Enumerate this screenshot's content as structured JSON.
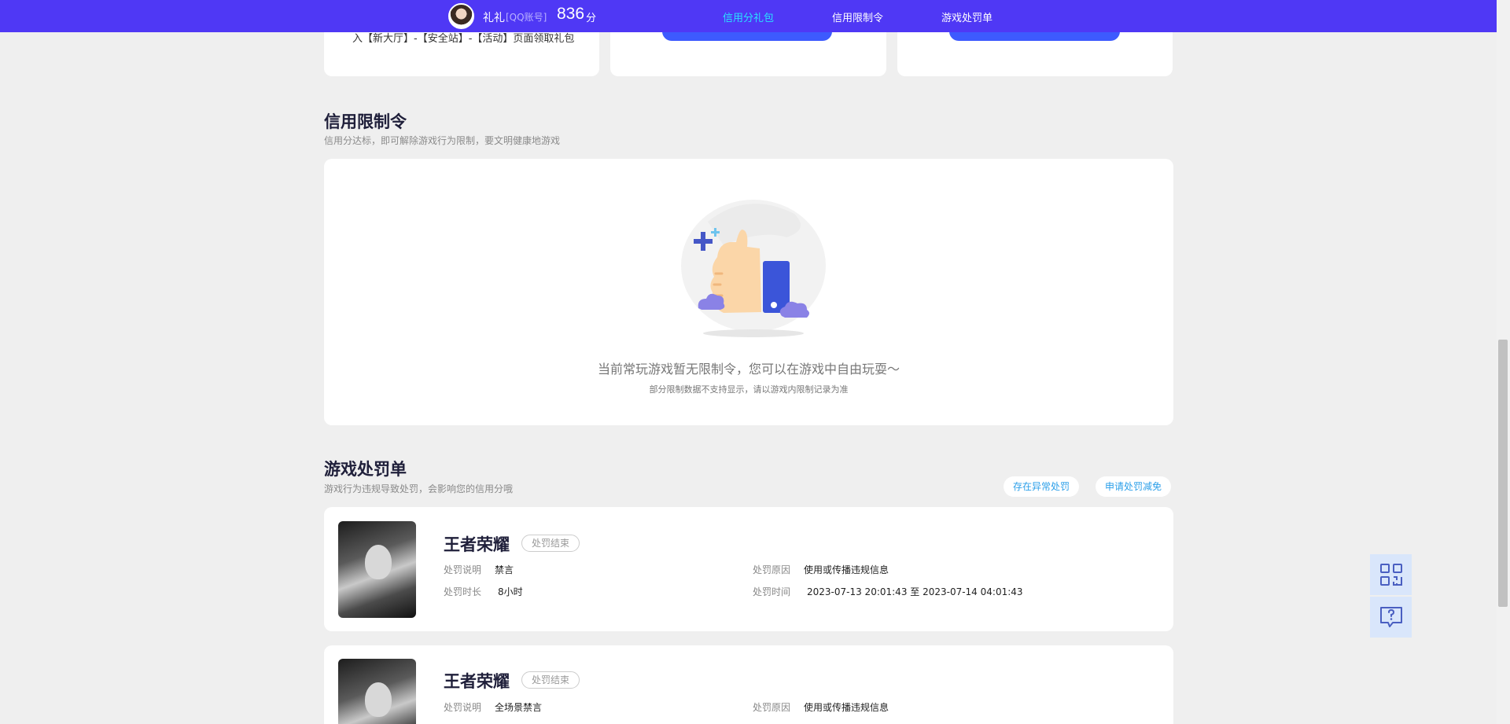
{
  "header": {
    "username": "礼礼",
    "account_tag": "[QQ账号]",
    "score": "836",
    "score_unit": "分",
    "tabs": [
      {
        "label": "信用分礼包",
        "active": true
      },
      {
        "label": "信用限制令",
        "active": false
      },
      {
        "label": "游戏处罚单",
        "active": false
      }
    ]
  },
  "gift_cards": {
    "card1_text": "入【新大厅】-【安全站】-【活动】页面领取礼包"
  },
  "restriction": {
    "title": "信用限制令",
    "subtitle": "信用分达标，即可解除游戏行为限制，要文明健康地游戏",
    "empty_message": "当前常玩游戏暂无限制令，您可以在游戏中自由玩耍～",
    "empty_note": "部分限制数据不支持显示，请以游戏内限制记录为准"
  },
  "penalty": {
    "title": "游戏处罚单",
    "subtitle": "游戏行为违规导致处罚，会影响您的信用分哦",
    "abnormal_btn": "存在异常处罚",
    "appeal_btn": "申请处罚减免",
    "records": [
      {
        "game": "王者荣耀",
        "status": "处罚结束",
        "desc_label": "处罚说明",
        "desc": "禁言",
        "duration_label": "处罚时长",
        "duration": "8小时",
        "reason_label": "处罚原因",
        "reason": "使用或传播违规信息",
        "time_label": "处罚时间",
        "time": "2023-07-13 20:01:43 至 2023-07-14 04:01:43"
      },
      {
        "game": "王者荣耀",
        "status": "处罚结束",
        "desc_label": "处罚说明",
        "desc": "全场景禁言",
        "reason_label": "处罚原因",
        "reason": "使用或传播违规信息"
      }
    ]
  },
  "colors": {
    "nav_bg": "#4f38f5",
    "active_tab": "#29e2ff",
    "accent_blue": "#3d5afe",
    "link_blue": "#2b9fe9"
  },
  "icons": [
    "qr-code-icon",
    "help-chat-icon",
    "thumbs-up-illustration"
  ]
}
